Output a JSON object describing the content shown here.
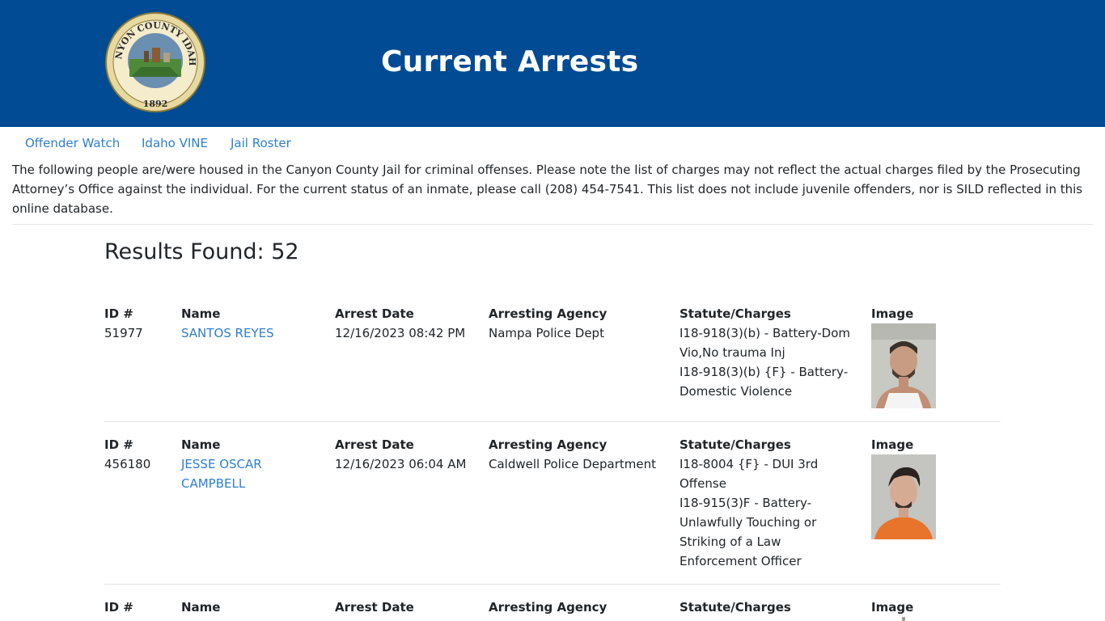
{
  "header": {
    "title": "Current Arrests",
    "seal": {
      "top_text": "CANYON COUNTY IDAHO",
      "year": "1892"
    },
    "colors": {
      "banner": "#004b93",
      "link": "#2d7fd3"
    }
  },
  "nav": {
    "items": [
      {
        "label": "Offender Watch"
      },
      {
        "label": "Idaho VINE"
      },
      {
        "label": "Jail Roster"
      }
    ]
  },
  "notice": "The following people are/were housed in the Canyon County Jail for criminal offenses. Please note the list of charges may not reflect the actual charges filed by the Prosecuting Attorney’s Office against the individual. For the current status of an inmate, please call (208) 454-7541. This list does not include juvenile offenders, nor is SILD reflected in this online database.",
  "results_label": "Results Found: 52",
  "columns": {
    "id": "ID #",
    "name": "Name",
    "date": "Arrest Date",
    "agency": "Arresting Agency",
    "charges": "Statute/Charges",
    "image": "Image"
  },
  "records": [
    {
      "id": "51977",
      "name": "SANTOS REYES",
      "date": "12/16/2023 08:42 PM",
      "agency": "Nampa Police Dept",
      "charges": [
        "I18-918(3)(b) - Battery-Dom Vio,No trauma Inj",
        "I18-918(3)(b) {F} - Battery-Domestic Violence"
      ],
      "shirt": "white"
    },
    {
      "id": "456180",
      "name": "JESSE OSCAR CAMPBELL",
      "date": "12/16/2023 06:04 AM",
      "agency": "Caldwell Police Department",
      "charges": [
        "I18-8004 {F} - DUI 3rd Offense",
        "I18-915(3)F - Battery-Unlawfully Touching or Striking of a Law Enforcement Officer"
      ],
      "shirt": "orange"
    },
    {
      "id": "",
      "name": "",
      "date": "",
      "agency": "",
      "charges": [],
      "shirt": "gray"
    }
  ]
}
